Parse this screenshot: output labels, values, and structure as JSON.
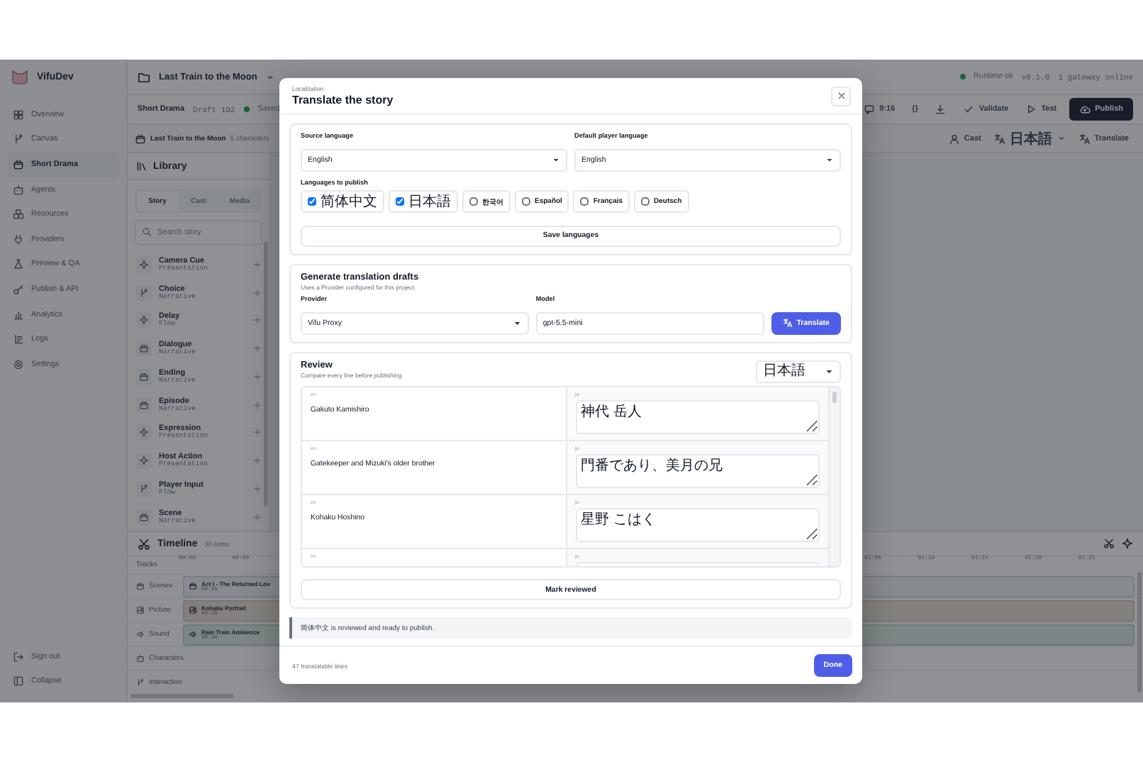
{
  "app": {
    "name": "VifuDev"
  },
  "nav": {
    "items": [
      {
        "label": "Overview",
        "selected": false
      },
      {
        "label": "Canvas",
        "selected": false
      },
      {
        "label": "Short Drama",
        "selected": true
      },
      {
        "label": "Agents",
        "selected": false
      },
      {
        "label": "Resources",
        "selected": false
      },
      {
        "label": "Providers",
        "selected": false
      },
      {
        "label": "Preview & QA",
        "selected": false
      },
      {
        "label": "Publish & API",
        "selected": false
      },
      {
        "label": "Analytics",
        "selected": false
      },
      {
        "label": "Logs",
        "selected": false
      },
      {
        "label": "Settings",
        "selected": false
      }
    ],
    "footer": [
      "Sign out",
      "Collapse"
    ]
  },
  "topbar": {
    "project": "Last Train to the Moon",
    "status": "Runtime ok",
    "version": "v0.1.0",
    "gateway": "1 gateway online"
  },
  "toolbar": {
    "title": "Short Drama",
    "draft": "Draft 102",
    "saved": "Saved",
    "ratio": "9:16",
    "braces": "{}",
    "validate": "Validate",
    "test": "Test",
    "publish": "Publish"
  },
  "story_bar": {
    "title": "Last Train to the Moon",
    "count": "5 characters",
    "cast": "Cast",
    "language": "日本語",
    "translate": "Translate"
  },
  "library": {
    "title": "Library",
    "tabs": [
      {
        "label": "Story",
        "selected": true
      },
      {
        "label": "Cast",
        "selected": false
      },
      {
        "label": "Media",
        "selected": false
      }
    ],
    "search": {
      "placeholder": "Search story"
    },
    "items": [
      {
        "name": "Camera Cue",
        "category": "Presentation"
      },
      {
        "name": "Choice",
        "category": "Narrative"
      },
      {
        "name": "Delay",
        "category": "Flow"
      },
      {
        "name": "Dialogue",
        "category": "Narrative"
      },
      {
        "name": "Ending",
        "category": "Narrative"
      },
      {
        "name": "Episode",
        "category": "Narrative"
      },
      {
        "name": "Expression",
        "category": "Presentation"
      },
      {
        "name": "Host Action",
        "category": "Presentation"
      },
      {
        "name": "Player Input",
        "category": "Flow"
      },
      {
        "name": "Scene",
        "category": "Narrative"
      }
    ]
  },
  "timeline": {
    "title": "Timeline",
    "count": "30 items",
    "tracks_label": "Tracks",
    "ticks_start": [
      "00:00",
      "00:05"
    ],
    "ticks_end": [
      "01:05",
      "01:10",
      "01:15",
      "01:20",
      "01:25"
    ],
    "tracks": [
      {
        "name": "Scenes",
        "clip": {
          "kind": "scene",
          "title": "Act I - The Returned Lov",
          "time": "00:25"
        }
      },
      {
        "name": "Picture",
        "clip": {
          "kind": "picture",
          "title": "Kohaku Portrait",
          "time": "00:30"
        }
      },
      {
        "name": "Sound",
        "clip": {
          "kind": "sound",
          "title": "Rain Train Ambience",
          "time": "00:30"
        }
      },
      {
        "name": "Characters"
      },
      {
        "name": "Interaction"
      }
    ]
  },
  "modal": {
    "eyebrow": "Localization",
    "title": "Translate the story",
    "languages": {
      "source_label": "Source language",
      "source": "English",
      "default_label": "Default player language",
      "default": "English",
      "publish_label": "Languages to publish",
      "options": [
        {
          "label": "简体中文",
          "checked": true
        },
        {
          "label": "日本語",
          "checked": true
        },
        {
          "label": "한국어",
          "checked": false
        },
        {
          "label": "Español",
          "checked": false
        },
        {
          "label": "Français",
          "checked": false
        },
        {
          "label": "Deutsch",
          "checked": false
        }
      ],
      "save": "Save languages"
    },
    "drafts": {
      "title": "Generate translation drafts",
      "subtitle": "Uses a Provider configured for this project.",
      "provider_label": "Provider",
      "provider": "Vifu Proxy",
      "model_label": "Model",
      "model": "gpt-5.5-mini",
      "translate": "Translate"
    },
    "review": {
      "title": "Review",
      "subtitle": "Compare every line before publishing.",
      "language": "日本語",
      "rows": [
        {
          "source_label": "en",
          "source": "Gakuto Kamishiro",
          "target_label": "ja",
          "target": "神代 岳人"
        },
        {
          "source_label": "en",
          "source": "Gatekeeper and Mizuki's older brother",
          "target_label": "ja",
          "target": "門番であり、美月の兄"
        },
        {
          "source_label": "en",
          "source": "Kohaku Hoshino",
          "target_label": "ja",
          "target": "星野 こはく"
        },
        {
          "source_label": "en",
          "target_label": "ja"
        }
      ],
      "mark": "Mark reviewed"
    },
    "notice": "简体中文 is reviewed and ready to publish.",
    "footer": {
      "count": "47 translatable lines",
      "done": "Done"
    }
  }
}
